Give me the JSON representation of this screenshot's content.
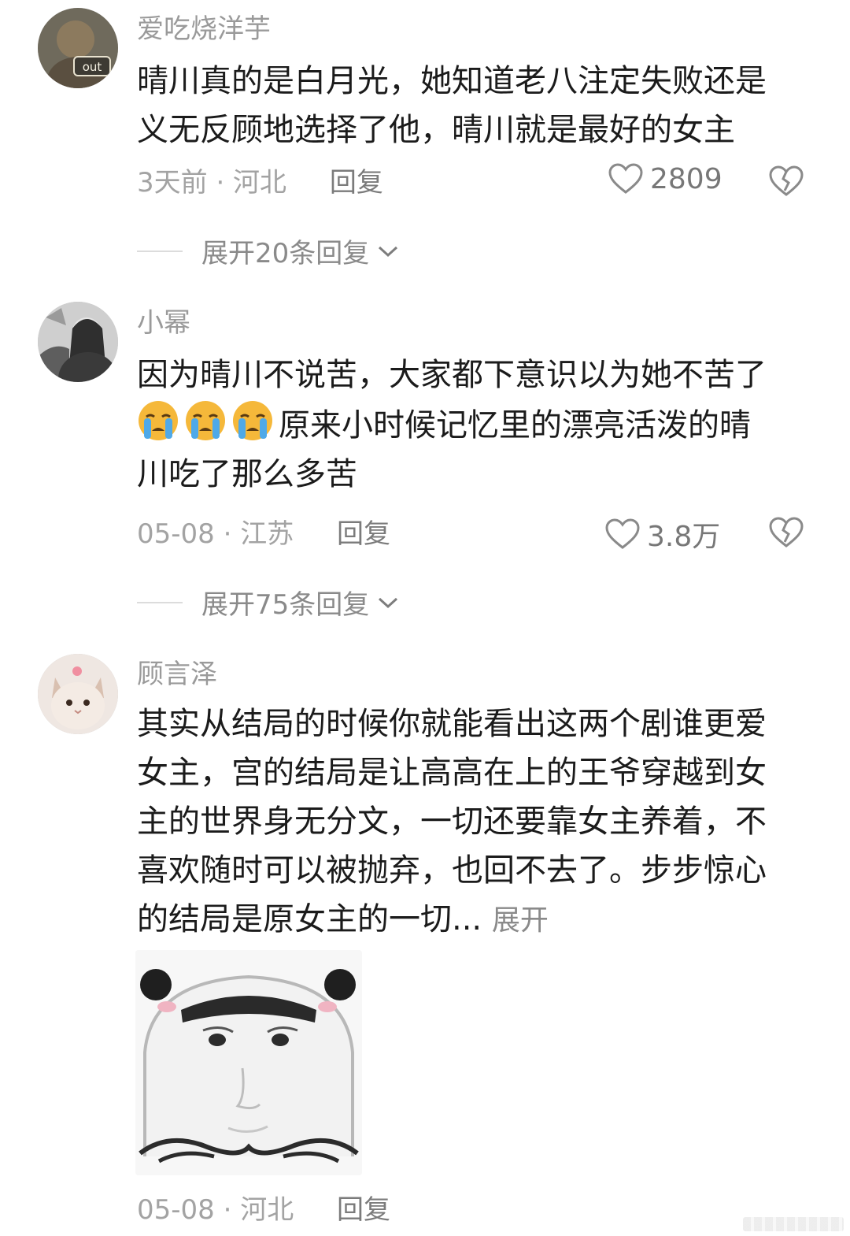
{
  "comments": [
    {
      "username": "爱吃烧洋芋",
      "avatar_badge": "out",
      "text_lines": [
        "晴川真的是白月光，她知道老八注定失败还是",
        "义无反顾地选择了他，晴川就是最好的女主"
      ],
      "meta": "3天前 · 河北",
      "reply_label": "回复",
      "likes": "2809",
      "expand_label": "展开20条回复"
    },
    {
      "username": "小幂",
      "text_line1": "因为晴川不说苦，大家都下意识以为她不苦了",
      "text_line2": "原来小时候记忆里的漂亮活泼的晴",
      "text_line3": "川吃了那么多苦",
      "meta": "05-08 · 江苏",
      "reply_label": "回复",
      "likes": "3.8万",
      "expand_label": "展开75条回复"
    },
    {
      "username": "顾言泽",
      "text_lines": [
        "其实从结局的时候你就能看出这两个剧谁更爱",
        "女主，宫的结局是让高高在上的王爷穿越到女",
        "主的世界身无分文，一切还要靠女主养着，不",
        "喜欢随时可以被抛弃，也回不去了。步步惊心"
      ],
      "text_last": "的结局是原女主的一切...",
      "more_label": "展开",
      "meta": "05-08 · 河北",
      "reply_label": "回复"
    }
  ],
  "icons": {
    "like": "heart-outline-icon",
    "dislike": "broken-heart-icon",
    "expand": "chevron-down-icon",
    "emoji": "crying-face-emoji"
  },
  "colors": {
    "text": "#1b1b1b",
    "muted": "#9a9a9a",
    "emoji": "#f5b83a"
  }
}
